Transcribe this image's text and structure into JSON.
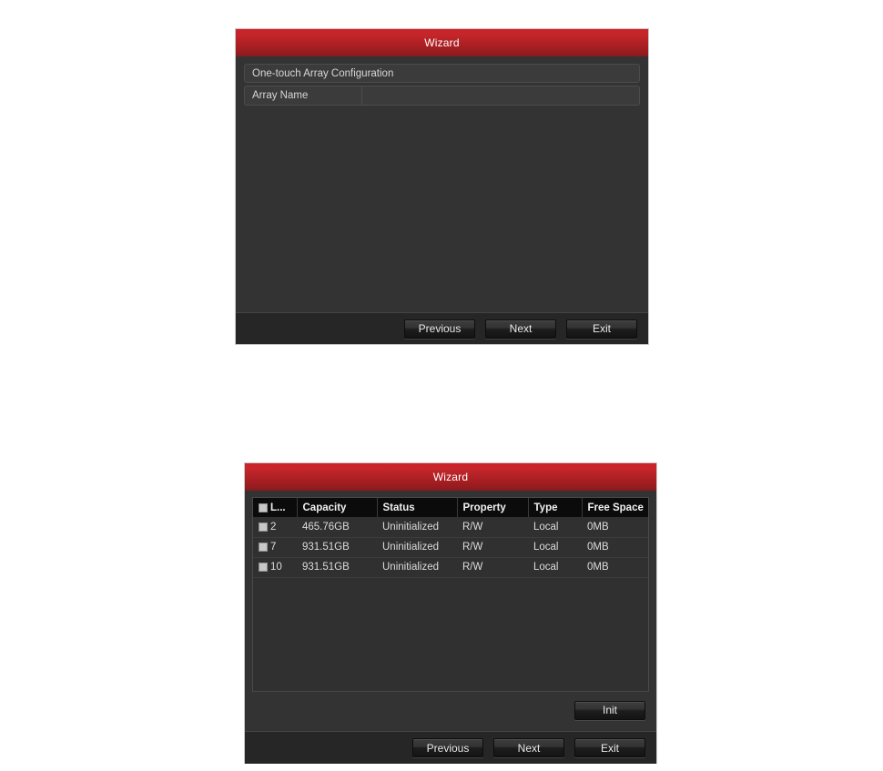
{
  "colors": {
    "title_red_top": "#cf2027",
    "title_red_bottom": "#8a1a1d",
    "dialog_bg": "#333333",
    "footer_bg": "#262626",
    "table_header_bg": "#0b0b0b",
    "checkbox_fill": "#c8c8c8",
    "page_bg": "#ffffff"
  },
  "array_dialog": {
    "title": "Wizard",
    "section_header": "One-touch Array Configuration",
    "array_name": {
      "label": "Array Name",
      "value": "",
      "placeholder": ""
    },
    "footer_buttons": [
      {
        "label": "Previous",
        "name": "previous-button"
      },
      {
        "label": "Next",
        "name": "next-button"
      },
      {
        "label": "Exit",
        "name": "exit-button"
      }
    ]
  },
  "hdd_dialog": {
    "title": "Wizard",
    "table": {
      "select_all_checked": false,
      "columns": [
        {
          "key": "label",
          "header": "L...",
          "has_checkbox": true
        },
        {
          "key": "capacity",
          "header": "Capacity",
          "has_checkbox": false
        },
        {
          "key": "status",
          "header": "Status",
          "has_checkbox": false
        },
        {
          "key": "property",
          "header": "Property",
          "has_checkbox": false
        },
        {
          "key": "type",
          "header": "Type",
          "has_checkbox": false
        },
        {
          "key": "free_space",
          "header": "Free Space",
          "has_checkbox": false
        }
      ],
      "rows": [
        {
          "checked": false,
          "label": "2",
          "capacity": "465.76GB",
          "status": "Uninitialized",
          "property": "R/W",
          "type": "Local",
          "free_space": "0MB"
        },
        {
          "checked": false,
          "label": "7",
          "capacity": "931.51GB",
          "status": "Uninitialized",
          "property": "R/W",
          "type": "Local",
          "free_space": "0MB"
        },
        {
          "checked": false,
          "label": "10",
          "capacity": "931.51GB",
          "status": "Uninitialized",
          "property": "R/W",
          "type": "Local",
          "free_space": "0MB"
        }
      ]
    },
    "init_button": {
      "label": "Init",
      "name": "init-button"
    },
    "footer_buttons": [
      {
        "label": "Previous",
        "name": "previous-button"
      },
      {
        "label": "Next",
        "name": "next-button"
      },
      {
        "label": "Exit",
        "name": "exit-button"
      }
    ]
  }
}
